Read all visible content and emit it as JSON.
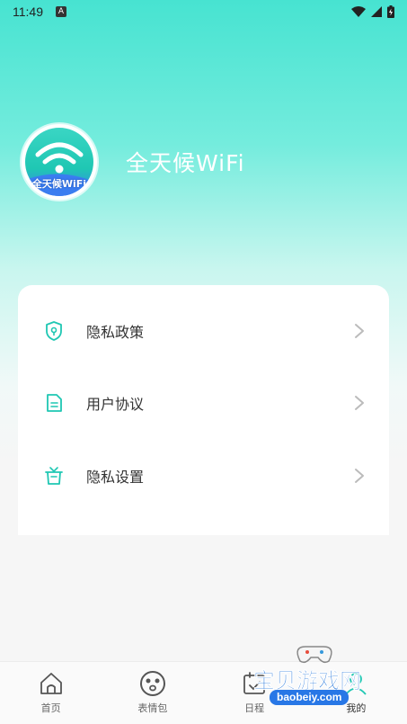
{
  "status_bar": {
    "time": "11:49",
    "notification_letter": "A"
  },
  "profile": {
    "app_name": "全天候WiFi",
    "avatar_text": "全天候WiFi"
  },
  "menu": [
    {
      "label": "隐私政策",
      "icon": "shield-icon"
    },
    {
      "label": "用户协议",
      "icon": "document-icon"
    },
    {
      "label": "隐私设置",
      "icon": "gift-box-icon"
    }
  ],
  "tabbar": [
    {
      "label": "首页",
      "icon": "home-icon"
    },
    {
      "label": "表情包",
      "icon": "emoji-icon"
    },
    {
      "label": "日程",
      "icon": "calendar-icon"
    },
    {
      "label": "我的",
      "icon": "user-icon",
      "active": true
    }
  ],
  "watermark": {
    "title": "宝贝游戏网",
    "url": "baobeiy.com"
  },
  "colors": {
    "accent": "#1fc7b3",
    "gradient_top": "#47e3d1",
    "background": "#f6f6f6"
  }
}
